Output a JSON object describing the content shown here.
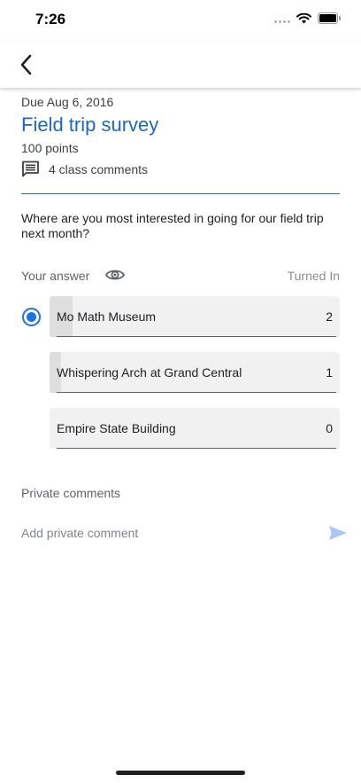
{
  "status_bar": {
    "time": "7:26"
  },
  "app_bar": {
    "back_icon": "chevron-left-icon"
  },
  "assignment": {
    "due": "Due Aug 6, 2016",
    "title": "Field trip survey",
    "points": "100 points",
    "comments_icon": "comment-icon",
    "class_comments": "4 class comments"
  },
  "question": "Where are you most interested in going for our field trip next month?",
  "answer_section": {
    "your_answer_label": "Your answer",
    "eye_icon": "eye-icon",
    "status": "Turned In"
  },
  "options": [
    {
      "label": "Mo Math Museum",
      "count": "2",
      "share": 0.08,
      "selected": true
    },
    {
      "label": "Whispering Arch at Grand Central",
      "count": "1",
      "share": 0.04,
      "selected": false
    },
    {
      "label": "Empire State Building",
      "count": "0",
      "share": 0,
      "selected": false
    }
  ],
  "private_comments": {
    "label": "Private comments",
    "placeholder": "Add private comment",
    "send_icon": "send-icon"
  },
  "colors": {
    "accent": "#1a73e8",
    "title": "#1967d2",
    "send_disabled": "#a8c7fa"
  }
}
